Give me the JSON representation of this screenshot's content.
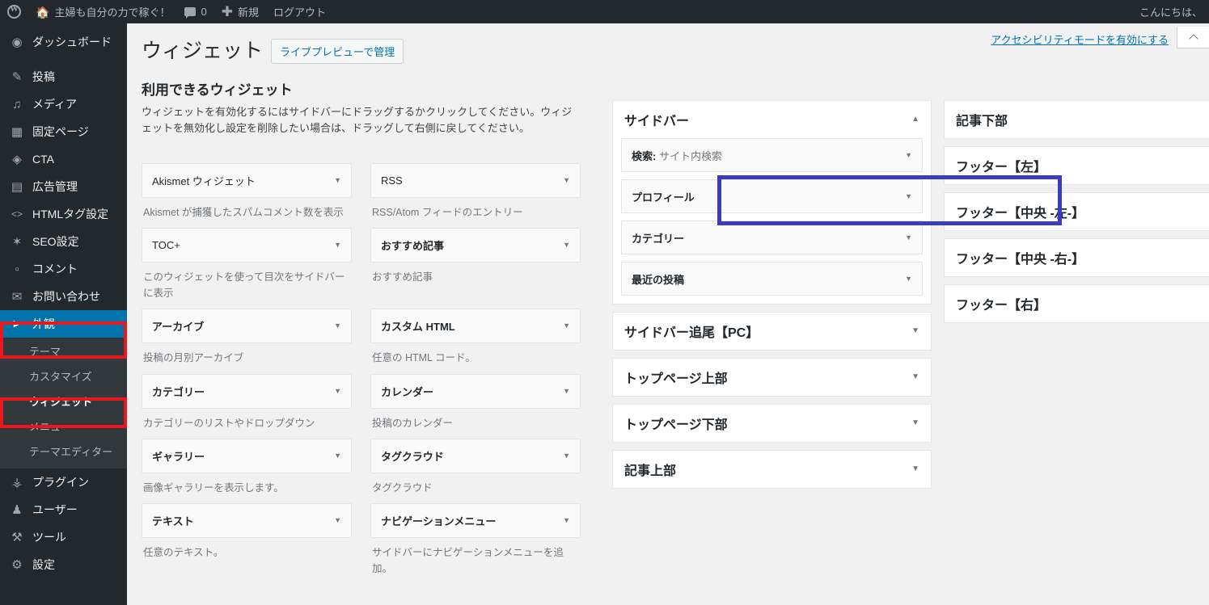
{
  "adminbar": {
    "logo_icon": "wordpress-logo-icon",
    "site_home_icon": "home-icon",
    "site_name": "主婦も自分の力で稼ぐ！",
    "comments_icon": "comment-bubble-icon",
    "comments_count": "0",
    "new_icon": "plus-icon",
    "new_label": "新規",
    "logout_label": "ログアウト",
    "greeting": "こんにちは、"
  },
  "adminmenu": {
    "items": [
      {
        "label": "ダッシュボード",
        "icon": "dashboard-icon",
        "glyph": "◴"
      },
      {
        "label": "投稿",
        "icon": "posts-pin-icon",
        "glyph": "✎"
      },
      {
        "label": "メディア",
        "icon": "media-icon",
        "glyph": "♫"
      },
      {
        "label": "固定ページ",
        "icon": "pages-icon",
        "glyph": "▯"
      },
      {
        "label": "CTA",
        "icon": "cta-icon",
        "glyph": "◈"
      },
      {
        "label": "広告管理",
        "icon": "ads-icon",
        "glyph": "▤"
      },
      {
        "label": "HTMLタグ設定",
        "icon": "code-icon",
        "glyph": "<>"
      },
      {
        "label": "SEO設定",
        "icon": "gear-icon",
        "glyph": "✿"
      },
      {
        "label": "コメント",
        "icon": "comment-icon",
        "glyph": "❏"
      },
      {
        "label": "お問い合わせ",
        "icon": "mail-icon",
        "glyph": "✉"
      }
    ],
    "appearance": {
      "label": "外観",
      "icon": "appearance-brush-icon",
      "glyph": "▶"
    },
    "appearance_submenu": [
      {
        "label": "テーマ",
        "current": false
      },
      {
        "label": "カスタマイズ",
        "current": false
      },
      {
        "label": "ウィジェット",
        "current": true
      },
      {
        "label": "メニュー",
        "current": false
      },
      {
        "label": "テーマエディター",
        "current": false
      }
    ],
    "items_after": [
      {
        "label": "プラグイン",
        "icon": "plugins-icon",
        "glyph": "⚲"
      },
      {
        "label": "ユーザー",
        "icon": "users-icon",
        "glyph": "♟"
      },
      {
        "label": "ツール",
        "icon": "tools-wrench-icon",
        "glyph": "⚒"
      },
      {
        "label": "設定",
        "icon": "settings-icon",
        "glyph": "⚙"
      }
    ]
  },
  "screen_meta": {
    "accessibility_link": "アクセシビリティモードを有効にする",
    "collapse_icon": "chevron-up-icon"
  },
  "page": {
    "title": "ウィジェット",
    "live_preview_button": "ライブプレビューで管理",
    "available_title": "利用できるウィジェット",
    "available_desc": "ウィジェットを有効化するにはサイドバーにドラッグするかクリックしてください。ウィジェットを無効化し設定を削除したい場合は、ドラッグして右側に戻してください。"
  },
  "available_widgets": [
    {
      "name": "Akismet ウィジェット",
      "desc": "Akismet が捕獲したスパムコメント数を表示",
      "bold": false
    },
    {
      "name": "RSS",
      "desc": "RSS/Atom フィードのエントリー",
      "bold": false
    },
    {
      "name": "TOC+",
      "desc": "このウィジェットを使って目次をサイドバーに表示",
      "bold": false
    },
    {
      "name": "おすすめ記事",
      "desc": "おすすめ記事",
      "bold": true
    },
    {
      "name": "アーカイブ",
      "desc": "投稿の月別アーカイブ",
      "bold": true
    },
    {
      "name": "カスタム HTML",
      "desc": "任意の HTML コード。",
      "bold": true
    },
    {
      "name": "カテゴリー",
      "desc": "カテゴリーのリストやドロップダウン",
      "bold": true
    },
    {
      "name": "カレンダー",
      "desc": "投稿のカレンダー",
      "bold": true
    },
    {
      "name": "ギャラリー",
      "desc": "画像ギャラリーを表示します。",
      "bold": true
    },
    {
      "name": "タグクラウド",
      "desc": "タグクラウド",
      "bold": true
    },
    {
      "name": "テキスト",
      "desc": "任意のテキスト。",
      "bold": true
    },
    {
      "name": "ナビゲーションメニュー",
      "desc": "サイドバーにナビゲーションメニューを追加。",
      "bold": true
    }
  ],
  "widget_areas_col1": [
    {
      "title": "サイドバー",
      "toggle": "▲",
      "expanded": true,
      "widgets": [
        {
          "label": "検索:",
          "sublabel": " サイト内検索"
        },
        {
          "label": "プロフィール",
          "sublabel": ""
        },
        {
          "label": "カテゴリー",
          "sublabel": ""
        },
        {
          "label": "最近の投稿",
          "sublabel": ""
        }
      ]
    },
    {
      "title": "サイドバー追尾【PC】",
      "toggle": "▼",
      "expanded": false,
      "widgets": []
    },
    {
      "title": "トップページ上部",
      "toggle": "▼",
      "expanded": false,
      "widgets": []
    },
    {
      "title": "トップページ下部",
      "toggle": "▼",
      "expanded": false,
      "widgets": []
    },
    {
      "title": "記事上部",
      "toggle": "▼",
      "expanded": false,
      "widgets": []
    }
  ],
  "widget_areas_col2": [
    {
      "title": "記事下部",
      "toggle": "▼",
      "expanded": false,
      "widgets": []
    },
    {
      "title": "フッター【左】",
      "toggle": "▼",
      "expanded": false,
      "widgets": []
    },
    {
      "title": "フッター【中央 -左-】",
      "toggle": "▼",
      "expanded": false,
      "widgets": []
    },
    {
      "title": "フッター【中央 -右-】",
      "toggle": "▼",
      "expanded": false,
      "widgets": []
    },
    {
      "title": "フッター【右】",
      "toggle": "▼",
      "expanded": false,
      "widgets": []
    }
  ],
  "annotations": {
    "highlight_blue_color": "#3b3bc4",
    "highlight_red_color": "#e8191e",
    "highlighted_widget": "プロフィール",
    "highlighted_menu_1": "外観",
    "highlighted_menu_2": "ウィジェット"
  },
  "colors": {
    "admin_dark": "#23282d",
    "admin_submenu": "#32373c",
    "accent_blue": "#0073aa",
    "content_bg": "#f1f1f1"
  }
}
